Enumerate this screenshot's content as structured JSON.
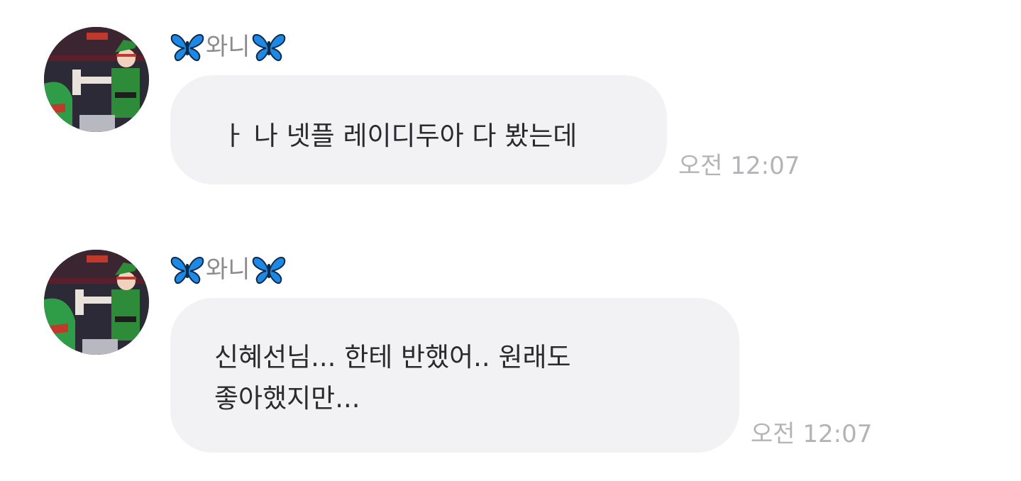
{
  "messages": [
    {
      "sender": {
        "name": "와니",
        "emoji_icon": "blue-butterfly-icon"
      },
      "text": "ㅏ 나 넷플 레이디두아 다 봤는데",
      "time": "오전 12:07"
    },
    {
      "sender": {
        "name": "와니",
        "emoji_icon": "blue-butterfly-icon"
      },
      "text": "신혜선님... 한테 반했어.. 원래도\n좋아했지만...",
      "time": "오전 12:07"
    }
  ],
  "colors": {
    "bubble_background": "#f2f2f4",
    "message_text": "#2b2b2e",
    "sender_name": "#8a8a8f",
    "timestamp": "#b4b4b8",
    "butterfly_blue": "#1e88e5"
  }
}
